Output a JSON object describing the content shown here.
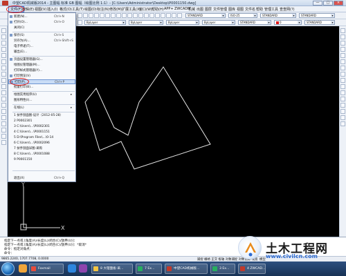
{
  "window": {
    "title": "中望CAD机械版2014 - 主图幅 标准 GB 图幅（绘图比例 1:1）- [C:\\Users\\Administrator\\Desktop\\P0001150.dwg]",
    "buttons": [
      "—",
      "□",
      "×"
    ]
  },
  "menubar": {
    "items": [
      "文件(F)",
      "编辑(E)",
      "视图(V)",
      "插入(I)",
      "格式(O)",
      "工具(T)",
      "绘图(D)",
      "标注(N)",
      "修改(M)",
      "扩展工具(X)",
      "窗口(W)",
      "帮助(H)",
      "APP+",
      "ZWCADM",
      "机械",
      "出图",
      "图层",
      "文件管理",
      "图库",
      "视图",
      "文件名",
      "帮助",
      "管理工具",
      "查查网(?)"
    ]
  },
  "toolbar": {
    "linetype": "ByLayer",
    "layer": "0",
    "layer_combo": "STANDARD",
    "color": "ByLayer",
    "linetype2": "ByLayer",
    "lineweight": "ByLayer",
    "textstyle": "STANDARD",
    "dimstyle": "ISO-25",
    "tablestyle": "STANDARD",
    "textstyle2": "STANDARD",
    "layer2": "0",
    "layer2_combo": "STANDARD",
    "colors": {
      "red": "#e01b1b",
      "yellow": "#ffd400"
    }
  },
  "file_menu": {
    "items": [
      {
        "label": "新建(N)...",
        "shortcut": "Ctrl+N"
      },
      {
        "label": "打开(O)...",
        "shortcut": "Ctrl+O"
      },
      {
        "label": "关闭(C)",
        "shortcut": ""
      },
      {
        "label": "保存(S)",
        "shortcut": "Ctrl+S"
      },
      {
        "label": "另存为(A)...",
        "shortcut": "Ctrl+Shift+S"
      },
      {
        "label": "电子传递(T)...",
        "shortcut": ""
      },
      {
        "label": "输出(E)...",
        "shortcut": ""
      },
      {
        "label": "页面设置管理器(G)...",
        "shortcut": ""
      },
      {
        "label": "绘图仪管理器(M)...",
        "shortcut": ""
      },
      {
        "label": "打印样式管理器(Y)...",
        "shortcut": ""
      },
      {
        "label": "打印预览(V)",
        "shortcut": ""
      },
      {
        "label": "打印(P)...",
        "shortcut": "Ctrl+P",
        "highlighted": true
      },
      {
        "label": "批量打印(B)...",
        "shortcut": ""
      },
      {
        "label": "绘图实用程序(U)",
        "shortcut": "",
        "submenu": true
      },
      {
        "label": "图形特性(I)...",
        "shortcut": ""
      },
      {
        "label": "在线(L)",
        "shortcut": "",
        "submenu": true
      },
      {
        "label": "1 扶手剖面图-设计（2012-05-28）",
        "shortcut": ""
      },
      {
        "label": "2 P0002301",
        "shortcut": ""
      },
      {
        "label": "3 C:\\Users\\...\\P0002301",
        "shortcut": ""
      },
      {
        "label": "4 C:\\Users\\...\\P0001151",
        "shortcut": ""
      },
      {
        "label": "5 D:\\Program Files\\...\\0-14",
        "shortcut": ""
      },
      {
        "label": "6 C:\\Users\\...\\P0002096",
        "shortcut": ""
      },
      {
        "label": "7 扶手剖面详图-采购",
        "shortcut": ""
      },
      {
        "label": "8 C:\\Users\\...\\P0001088",
        "shortcut": ""
      },
      {
        "label": "9 P0001150",
        "shortcut": ""
      },
      {
        "label": "退出(X)",
        "shortcut": "Ctrl+Q"
      }
    ]
  },
  "canvas": {
    "ucs_x": "X",
    "ucs_y": "Y"
  },
  "command": {
    "lines": [
      "指定下一点或 [角度(A)/长度(L)/闭合(C)/放弃(U)]：",
      "指定下一点或 [角度(A)/长度(L)/闭合(C)/放弃(U)]：*取消*",
      "命令：指定对角点："
    ],
    "prompt": "命令："
  },
  "statusbar": {
    "coords": "9865.2240, 1707.7708, 0.0000",
    "modes": "捕捉 栅格 正交 极轴 对象捕捉 对象追踪 线宽",
    "model": "模型"
  },
  "taskbar": {
    "tasks": [
      "Foxmail",
      "8 大理面板-采...",
      "7 Ex...",
      "中望CAD机械版...",
      "3 Ex...",
      "4 ZWCAD..."
    ]
  },
  "watermark": {
    "text": "土木工程网",
    "url": "www.civilcn.com"
  }
}
